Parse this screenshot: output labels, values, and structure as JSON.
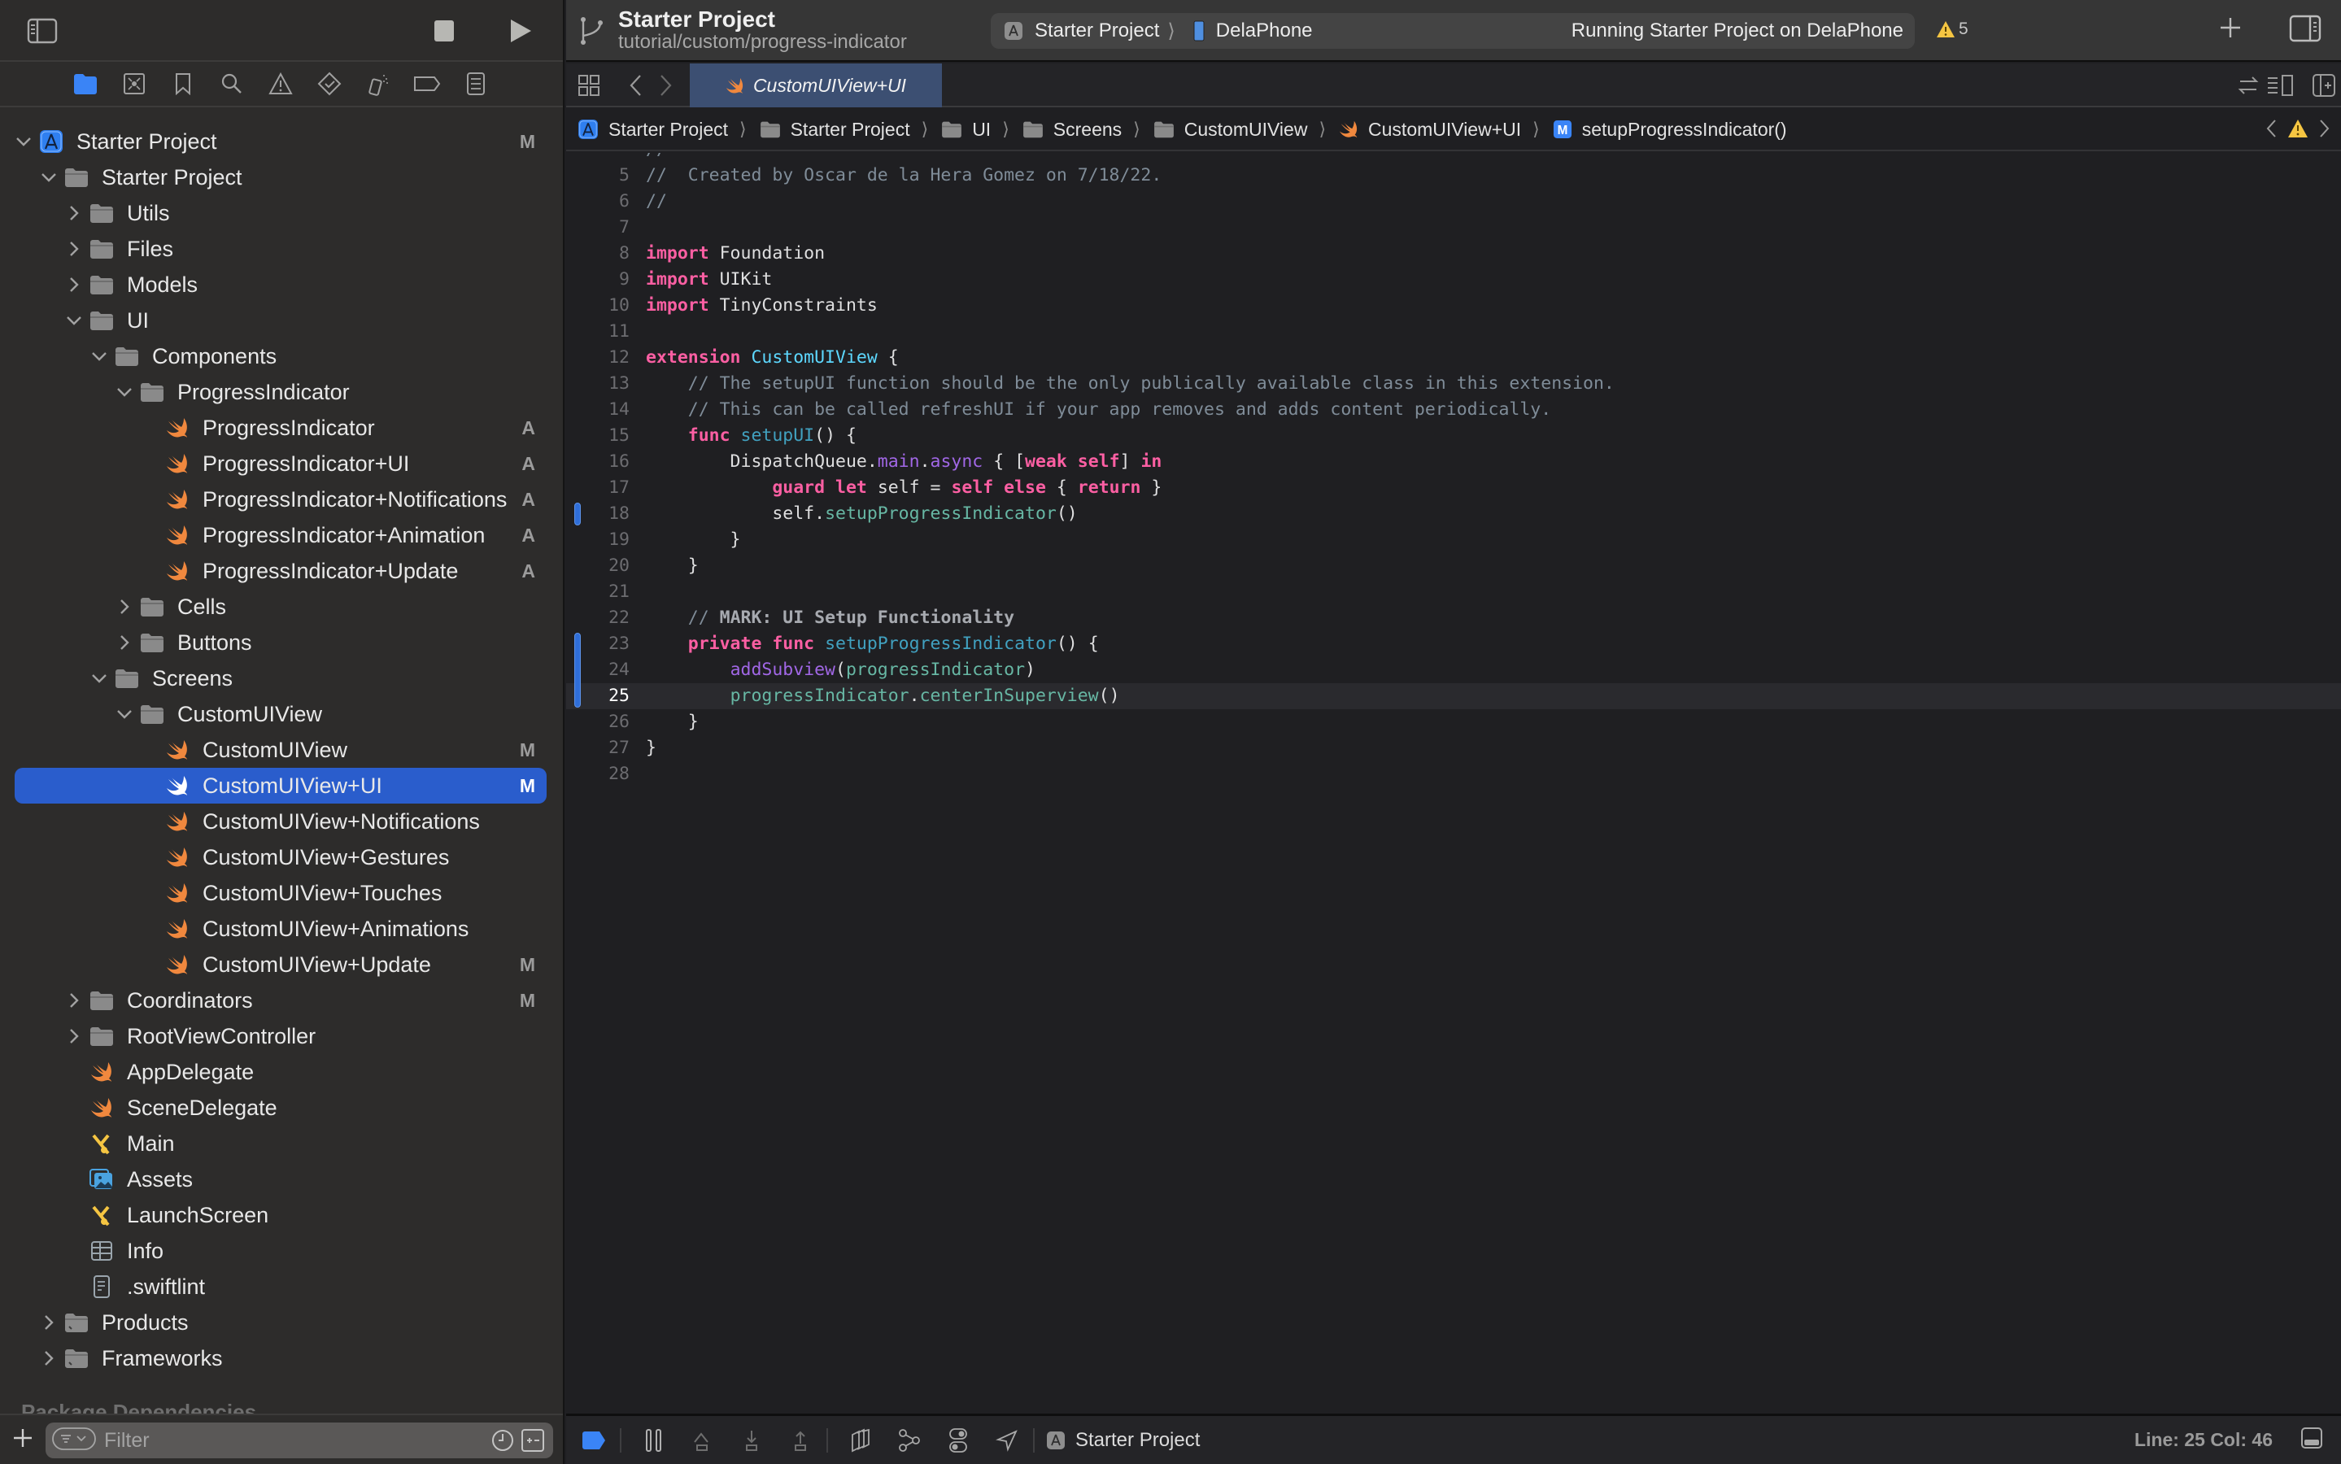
{
  "toolbar": {
    "project_name": "Starter Project",
    "branch": "tutorial/custom/progress-indicator",
    "scheme": "Starter Project",
    "device": "DelaPhone",
    "status": "Running Starter Project on DelaPhone",
    "warning_count": "5"
  },
  "sidebar": {
    "navigator_tabs": [
      "project-navigator",
      "source-control-navigator",
      "bookmark-navigator",
      "find-navigator",
      "issue-navigator",
      "test-navigator",
      "debug-navigator",
      "breakpoint-navigator",
      "report-navigator"
    ],
    "active_navigator": "project-navigator",
    "tree": [
      {
        "label": "Starter Project",
        "kind": "project",
        "depth": 0,
        "disclosure": "open",
        "badge": "M"
      },
      {
        "label": "Starter Project",
        "kind": "folder",
        "depth": 1,
        "disclosure": "open",
        "badge": ""
      },
      {
        "label": "Utils",
        "kind": "folder",
        "depth": 2,
        "disclosure": "closed",
        "badge": ""
      },
      {
        "label": "Files",
        "kind": "folder",
        "depth": 2,
        "disclosure": "closed",
        "badge": ""
      },
      {
        "label": "Models",
        "kind": "folder",
        "depth": 2,
        "disclosure": "closed",
        "badge": ""
      },
      {
        "label": "UI",
        "kind": "folder",
        "depth": 2,
        "disclosure": "open",
        "badge": ""
      },
      {
        "label": "Components",
        "kind": "folder",
        "depth": 3,
        "disclosure": "open",
        "badge": ""
      },
      {
        "label": "ProgressIndicator",
        "kind": "folder",
        "depth": 4,
        "disclosure": "open",
        "badge": ""
      },
      {
        "label": "ProgressIndicator",
        "kind": "swift",
        "depth": 5,
        "disclosure": "none",
        "badge": "A"
      },
      {
        "label": "ProgressIndicator+UI",
        "kind": "swift",
        "depth": 5,
        "disclosure": "none",
        "badge": "A"
      },
      {
        "label": "ProgressIndicator+Notifications",
        "kind": "swift",
        "depth": 5,
        "disclosure": "none",
        "badge": "A"
      },
      {
        "label": "ProgressIndicator+Animation",
        "kind": "swift",
        "depth": 5,
        "disclosure": "none",
        "badge": "A"
      },
      {
        "label": "ProgressIndicator+Update",
        "kind": "swift",
        "depth": 5,
        "disclosure": "none",
        "badge": "A"
      },
      {
        "label": "Cells",
        "kind": "folder",
        "depth": 4,
        "disclosure": "closed",
        "badge": ""
      },
      {
        "label": "Buttons",
        "kind": "folder",
        "depth": 4,
        "disclosure": "closed",
        "badge": ""
      },
      {
        "label": "Screens",
        "kind": "folder",
        "depth": 3,
        "disclosure": "open",
        "badge": ""
      },
      {
        "label": "CustomUIView",
        "kind": "folder",
        "depth": 4,
        "disclosure": "open",
        "badge": ""
      },
      {
        "label": "CustomUIView",
        "kind": "swift",
        "depth": 5,
        "disclosure": "none",
        "badge": "M"
      },
      {
        "label": "CustomUIView+UI",
        "kind": "swift",
        "depth": 5,
        "disclosure": "none",
        "badge": "M",
        "selected": true
      },
      {
        "label": "CustomUIView+Notifications",
        "kind": "swift",
        "depth": 5,
        "disclosure": "none",
        "badge": ""
      },
      {
        "label": "CustomUIView+Gestures",
        "kind": "swift",
        "depth": 5,
        "disclosure": "none",
        "badge": ""
      },
      {
        "label": "CustomUIView+Touches",
        "kind": "swift",
        "depth": 5,
        "disclosure": "none",
        "badge": ""
      },
      {
        "label": "CustomUIView+Animations",
        "kind": "swift",
        "depth": 5,
        "disclosure": "none",
        "badge": ""
      },
      {
        "label": "CustomUIView+Update",
        "kind": "swift",
        "depth": 5,
        "disclosure": "none",
        "badge": "M"
      },
      {
        "label": "Coordinators",
        "kind": "folder",
        "depth": 2,
        "disclosure": "closed",
        "badge": "M"
      },
      {
        "label": "RootViewController",
        "kind": "folder",
        "depth": 2,
        "disclosure": "closed",
        "badge": ""
      },
      {
        "label": "AppDelegate",
        "kind": "swift",
        "depth": 2,
        "disclosure": "none",
        "badge": ""
      },
      {
        "label": "SceneDelegate",
        "kind": "swift",
        "depth": 2,
        "disclosure": "none",
        "badge": ""
      },
      {
        "label": "Main",
        "kind": "storyboard",
        "depth": 2,
        "disclosure": "none",
        "badge": ""
      },
      {
        "label": "Assets",
        "kind": "assets",
        "depth": 2,
        "disclosure": "none",
        "badge": ""
      },
      {
        "label": "LaunchScreen",
        "kind": "storyboard",
        "depth": 2,
        "disclosure": "none",
        "badge": ""
      },
      {
        "label": "Info",
        "kind": "plist",
        "depth": 2,
        "disclosure": "none",
        "badge": ""
      },
      {
        "label": ".swiftlint",
        "kind": "textfile",
        "depth": 2,
        "disclosure": "none",
        "badge": ""
      },
      {
        "label": "Products",
        "kind": "folder-special",
        "depth": 1,
        "disclosure": "closed",
        "badge": ""
      },
      {
        "label": "Frameworks",
        "kind": "folder-special",
        "depth": 1,
        "disclosure": "closed",
        "badge": ""
      }
    ],
    "section_header": "Package Dependencies",
    "filter_placeholder": "Filter"
  },
  "tabs": [
    {
      "label": "CustomUIView+UI",
      "active": true
    }
  ],
  "jumpbar": {
    "crumbs": [
      {
        "label": "Starter Project",
        "icon": "project-icon"
      },
      {
        "label": "Starter Project",
        "icon": "folder-icon"
      },
      {
        "label": "UI",
        "icon": "folder-icon"
      },
      {
        "label": "Screens",
        "icon": "folder-icon"
      },
      {
        "label": "CustomUIView",
        "icon": "folder-icon"
      },
      {
        "label": "CustomUIView+UI",
        "icon": "swift-file-icon"
      },
      {
        "label": "setupProgressIndicator()",
        "icon": "method-icon"
      }
    ],
    "method_badge": "M"
  },
  "editor": {
    "current_line": 25,
    "changed_lines": [
      18,
      23,
      24,
      25
    ],
    "lines": [
      {
        "n": 5,
        "tokens": [
          [
            "cm",
            "//  Created by Oscar de la Hera Gomez on 7/18/22."
          ]
        ]
      },
      {
        "n": 6,
        "tokens": [
          [
            "cm",
            "//"
          ]
        ]
      },
      {
        "n": 7,
        "tokens": []
      },
      {
        "n": 8,
        "tokens": [
          [
            "kw",
            "import"
          ],
          [
            "pl",
            " Foundation"
          ]
        ]
      },
      {
        "n": 9,
        "tokens": [
          [
            "kw",
            "import"
          ],
          [
            "pl",
            " UIKit"
          ]
        ]
      },
      {
        "n": 10,
        "tokens": [
          [
            "kw",
            "import"
          ],
          [
            "pl",
            " TinyConstraints"
          ]
        ]
      },
      {
        "n": 11,
        "tokens": []
      },
      {
        "n": 12,
        "tokens": [
          [
            "kw",
            "extension"
          ],
          [
            "pl",
            " "
          ],
          [
            "type",
            "CustomUIView"
          ],
          [
            "pl",
            " {"
          ]
        ]
      },
      {
        "n": 13,
        "tokens": [
          [
            "pl",
            "    "
          ],
          [
            "cm",
            "// The setupUI function should be the only publically available class in this extension."
          ]
        ]
      },
      {
        "n": 14,
        "tokens": [
          [
            "pl",
            "    "
          ],
          [
            "cm",
            "// This can be called refreshUI if your app removes and adds content periodically."
          ]
        ]
      },
      {
        "n": 15,
        "tokens": [
          [
            "pl",
            "    "
          ],
          [
            "kw",
            "func"
          ],
          [
            "pl",
            " "
          ],
          [
            "fnd",
            "setupUI"
          ],
          [
            "pl",
            "() {"
          ]
        ]
      },
      {
        "n": 16,
        "tokens": [
          [
            "pl",
            "        DispatchQueue."
          ],
          [
            "prop",
            "main"
          ],
          [
            "pl",
            "."
          ],
          [
            "prop",
            "async"
          ],
          [
            "pl",
            " { ["
          ],
          [
            "kw",
            "weak"
          ],
          [
            "pl",
            " "
          ],
          [
            "kw",
            "self"
          ],
          [
            "pl",
            "] "
          ],
          [
            "kw",
            "in"
          ]
        ]
      },
      {
        "n": 17,
        "tokens": [
          [
            "pl",
            "            "
          ],
          [
            "kw",
            "guard"
          ],
          [
            "pl",
            " "
          ],
          [
            "kw",
            "let"
          ],
          [
            "pl",
            " self = "
          ],
          [
            "kw",
            "self"
          ],
          [
            "pl",
            " "
          ],
          [
            "kw",
            "else"
          ],
          [
            "pl",
            " { "
          ],
          [
            "kw",
            "return"
          ],
          [
            "pl",
            " }"
          ]
        ]
      },
      {
        "n": 18,
        "tokens": [
          [
            "pl",
            "            self."
          ],
          [
            "fn",
            "setupProgressIndicator"
          ],
          [
            "pl",
            "()"
          ]
        ]
      },
      {
        "n": 19,
        "tokens": [
          [
            "pl",
            "        }"
          ]
        ]
      },
      {
        "n": 20,
        "tokens": [
          [
            "pl",
            "    }"
          ]
        ]
      },
      {
        "n": 21,
        "tokens": []
      },
      {
        "n": 22,
        "tokens": [
          [
            "pl",
            "    "
          ],
          [
            "cm",
            "// "
          ],
          [
            "cmb",
            "MARK: UI Setup Functionality"
          ]
        ]
      },
      {
        "n": 23,
        "tokens": [
          [
            "pl",
            "    "
          ],
          [
            "kw",
            "private"
          ],
          [
            "pl",
            " "
          ],
          [
            "kw",
            "func"
          ],
          [
            "pl",
            " "
          ],
          [
            "fnd",
            "setupProgressIndicator"
          ],
          [
            "pl",
            "() {"
          ]
        ]
      },
      {
        "n": 24,
        "tokens": [
          [
            "pl",
            "        "
          ],
          [
            "prop",
            "addSubview"
          ],
          [
            "pl",
            "("
          ],
          [
            "var",
            "progressIndicator"
          ],
          [
            "pl",
            ")"
          ]
        ]
      },
      {
        "n": 25,
        "tokens": [
          [
            "pl",
            "        "
          ],
          [
            "var",
            "progressIndicator"
          ],
          [
            "pl",
            "."
          ],
          [
            "fn",
            "centerInSuperview"
          ],
          [
            "pl",
            "()"
          ]
        ]
      },
      {
        "n": 26,
        "tokens": [
          [
            "pl",
            "    }"
          ]
        ]
      },
      {
        "n": 27,
        "tokens": [
          [
            "pl",
            "}"
          ]
        ]
      },
      {
        "n": 28,
        "tokens": []
      }
    ]
  },
  "debugbar": {
    "target": "Starter Project",
    "cursor_position": "Line: 25  Col: 46"
  },
  "colors": {
    "accent": "#2a5dcc",
    "swift_orange": "#f0883e",
    "warning_yellow": "#f5c542",
    "keyword": "#fc5fa3",
    "comment": "#7f8c98",
    "type": "#5dd8ff"
  }
}
